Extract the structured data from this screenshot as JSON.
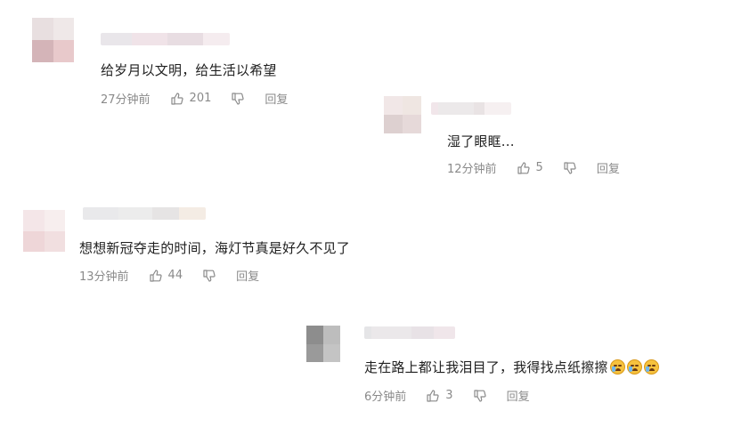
{
  "comments": [
    {
      "text": "给岁月以文明，给生活以希望",
      "time": "27分钟前",
      "likes": "201",
      "reply_label": "回复",
      "avatar_colors": [
        "#e8dfe0",
        "#efe8e8",
        "#d4b4b8",
        "#e8c9cb"
      ],
      "name_colors": [
        "#e9e6ea",
        "#f0e3e8",
        "#e8dde2",
        "#f5ecef"
      ]
    },
    {
      "text": "湿了眼眶...",
      "time": "12分钟前",
      "likes": "5",
      "reply_label": "回复",
      "avatar_colors": [
        "#f1e7e7",
        "#efe6e2",
        "#ddd0d0",
        "#e6d9d9"
      ],
      "name_colors": [
        "#f1e6ea",
        "#ece9ea",
        "#e9e3e4",
        "#f6f0f1"
      ]
    },
    {
      "text": "想想新冠夺走的时间，海灯节真是好久不见了",
      "time": "13分钟前",
      "likes": "44",
      "reply_label": "回复",
      "avatar_colors": [
        "#f4e6e8",
        "#f7eeee",
        "#eed6d8",
        "#f1dfe0"
      ],
      "name_colors": [
        "#e9e9eb",
        "#ececec",
        "#e6e4e4",
        "#f4ece4"
      ]
    },
    {
      "text": "走在路上都让我泪目了，我得找点纸擦擦",
      "emoji_names": [
        "crying-emoji",
        "crying-emoji",
        "crying-emoji"
      ],
      "time": "6分钟前",
      "likes": "3",
      "reply_label": "回复",
      "avatar_colors": [
        "#8d8d8d",
        "#bdbdbd",
        "#9a9a9a",
        "#c4c4c4"
      ],
      "name_colors": [
        "#e5e5e7",
        "#ebe8ea",
        "#e8e2e6",
        "#f0e6ea"
      ]
    }
  ],
  "icons": {
    "like": "thumbs-up-icon",
    "dislike": "thumbs-down-icon"
  }
}
